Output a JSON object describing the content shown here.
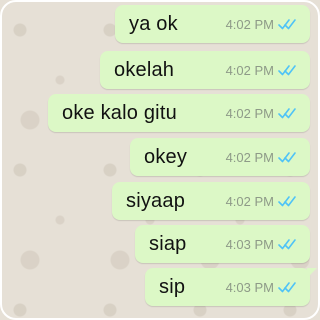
{
  "colors": {
    "bubble": "#dcf8c6",
    "tick": "#4fc3f7",
    "wallpaper": "#e6e0d6"
  },
  "messages": [
    {
      "text": "ya ok",
      "time": "4:02 PM",
      "status": "read-double-tick-icon"
    },
    {
      "text": "okelah",
      "time": "4:02 PM",
      "status": "read-double-tick-icon"
    },
    {
      "text": "oke kalo gitu",
      "time": "4:02 PM",
      "status": "read-double-tick-icon"
    },
    {
      "text": "okey",
      "time": "4:02 PM",
      "status": "read-double-tick-icon"
    },
    {
      "text": "siyaap",
      "time": "4:02 PM",
      "status": "read-double-tick-icon"
    },
    {
      "text": "siap",
      "time": "4:03 PM",
      "status": "read-double-tick-icon"
    },
    {
      "text": "sip",
      "time": "4:03 PM",
      "status": "read-double-tick-icon"
    }
  ]
}
